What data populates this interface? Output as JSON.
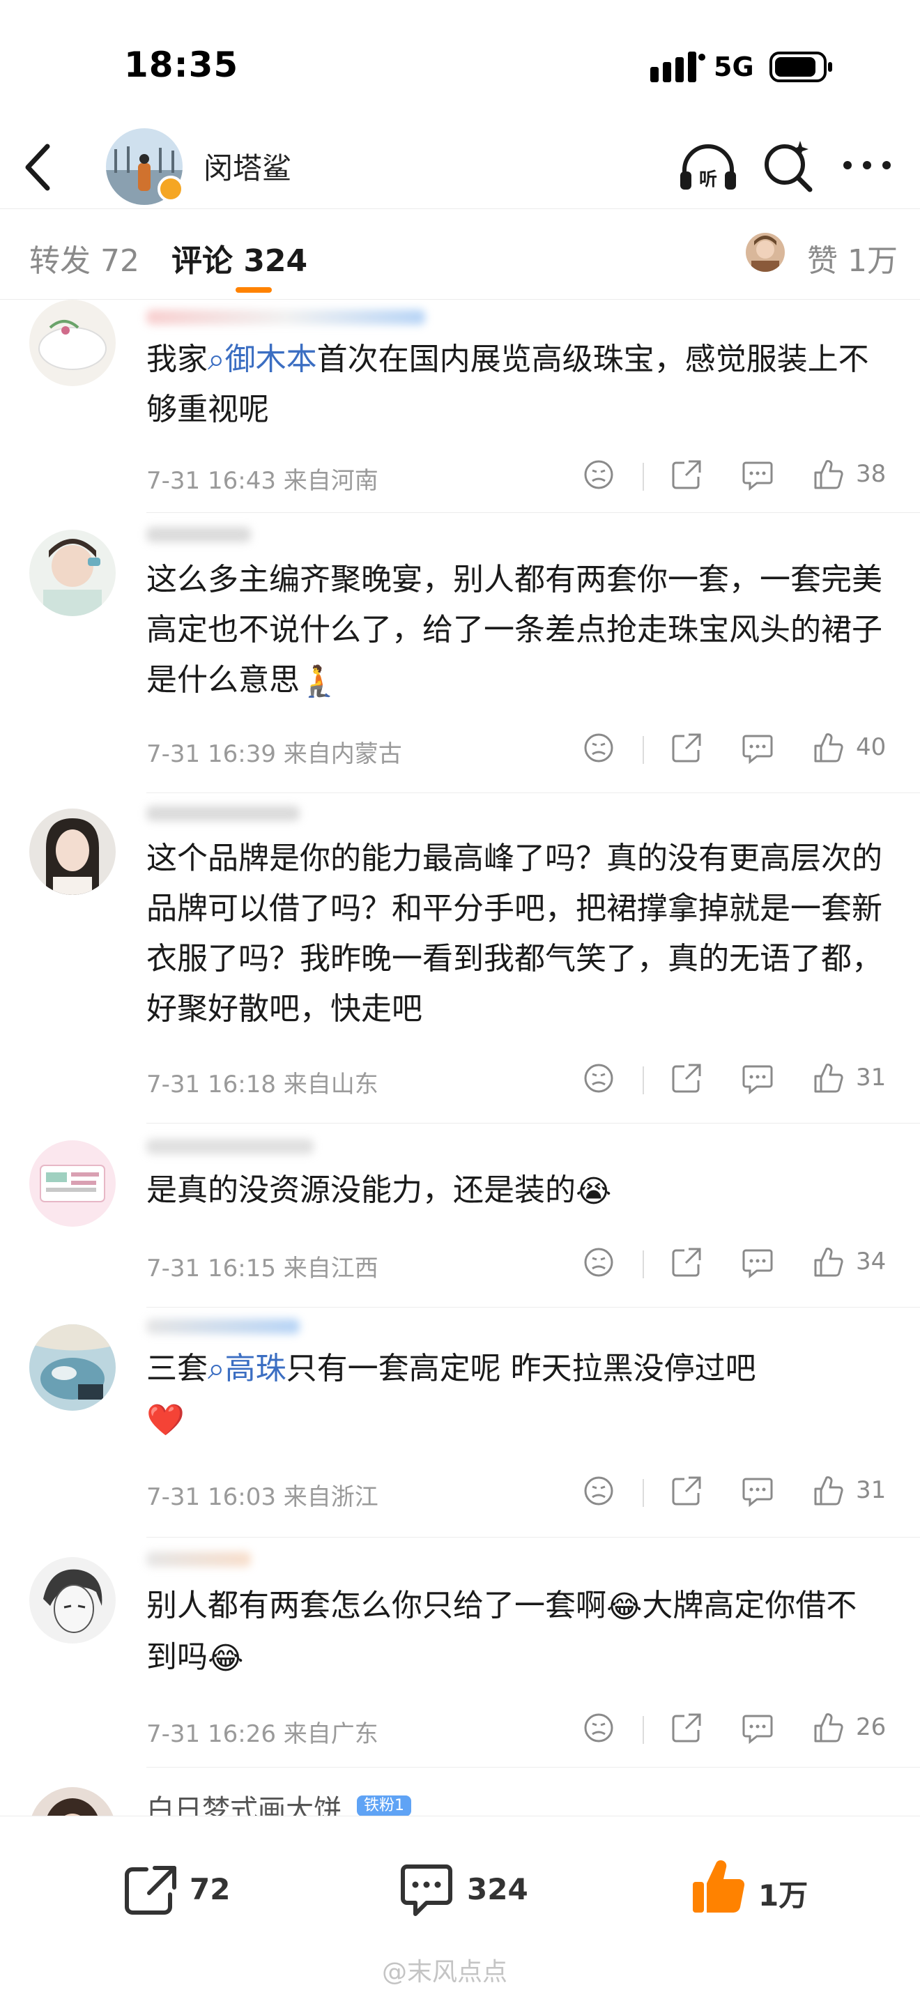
{
  "status_bar": {
    "time": "18:35",
    "network": "5G"
  },
  "nav": {
    "username": "闵塔鲨"
  },
  "tabs": {
    "repost": "转发 72",
    "comments": "评论 324",
    "likes": "赞 1万"
  },
  "colors": {
    "accent": "#ff8200",
    "link": "#3b6ec2",
    "meta": "#9a9a9a",
    "like_orange": "#ff8200"
  },
  "comments": [
    {
      "text_before": "我家",
      "link": "御木本",
      "text_after": "首次在国内展览高级珠宝，感觉服装上不够重视呢",
      "emoji": "",
      "meta": "7-31 16:43  来自河南",
      "likes": "38"
    },
    {
      "text": "这么多主编齐聚晚宴，别人都有两套你一套，一套完美高定也不说什么了，给了一条差点抢走珠宝风头的裙子是什么意思",
      "emoji": "🧎",
      "meta": "7-31 16:39  来自内蒙古",
      "likes": "40"
    },
    {
      "text": "这个品牌是你的能力最高峰了吗？真的没有更高层次的品牌可以借了吗？和平分手吧，把裙撑拿掉就是一套新衣服了吗？我昨晚一看到我都气笑了，真的无语了都，好聚好散吧，快走吧",
      "emoji": "",
      "meta": "7-31 16:18  来自山东",
      "likes": "31"
    },
    {
      "text": "是真的没资源没能力，还是装的",
      "emoji": "😭",
      "meta": "7-31 16:15  来自江西",
      "likes": "34"
    },
    {
      "text_before": "三套",
      "link": "高珠",
      "text_after": "只有一套高定呢 昨天拉黑没停过吧",
      "emoji": "❤️",
      "meta": "7-31 16:03  来自浙江",
      "likes": "31"
    },
    {
      "text_before": "别人都有两套怎么你只给了一套啊",
      "emoji_mid": "😂",
      "text_after": "大牌高定你借不到吗",
      "emoji": "😂",
      "meta": "7-31 16:26  来自广东",
      "likes": "26"
    },
    {
      "name": "白日梦式画大饼",
      "fan_badge": "铁粉1"
    }
  ],
  "bottom_bar": {
    "repost_count": "72",
    "comment_count": "324",
    "like_count": "1万"
  },
  "watermark": "@末风点点"
}
